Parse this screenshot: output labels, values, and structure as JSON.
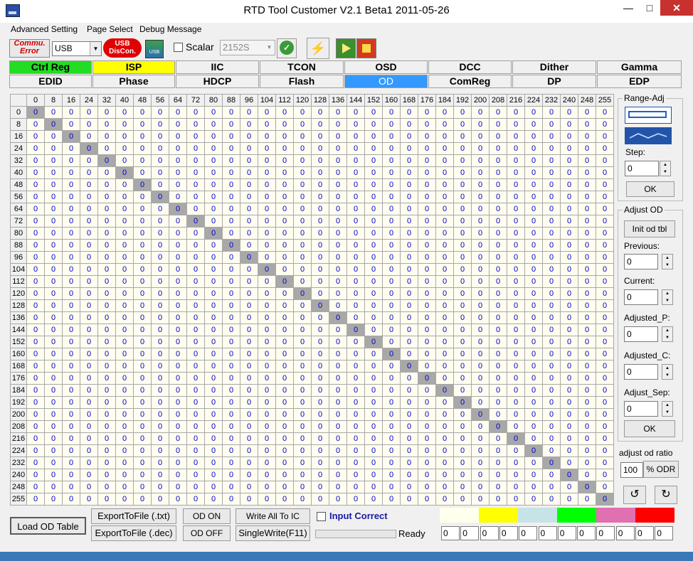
{
  "window": {
    "title": "RTD Tool Customer V2.1 Beta1   2011-05-26"
  },
  "menu": [
    "Advanced Setting",
    "Page Select",
    "Debug Message"
  ],
  "toolbar": {
    "status_line1": "Commu.",
    "status_line2": "Error",
    "port": "USB",
    "disconnect_line1": "USB",
    "disconnect_line2": "DisCon.",
    "usb_icon_label": "USB",
    "scalar_label": "Scalar",
    "scalar_value": "2152S"
  },
  "tabs_row1": [
    "Ctrl Reg",
    "ISP",
    "IIC",
    "TCON",
    "OSD",
    "DCC",
    "Dither",
    "Gamma"
  ],
  "tabs_row2": [
    "EDID",
    "Phase",
    "HDCP",
    "Flash",
    "OD",
    "ComReg",
    "DP",
    "EDP"
  ],
  "tab_colors": {
    "Ctrl Reg": "#22dd22",
    "ISP": "#ffff00",
    "OD": "#3399ff"
  },
  "od_table": {
    "columns": [
      0,
      8,
      16,
      24,
      32,
      40,
      48,
      56,
      64,
      72,
      80,
      88,
      96,
      104,
      112,
      120,
      128,
      136,
      144,
      152,
      160,
      168,
      176,
      184,
      192,
      200,
      208,
      216,
      224,
      232,
      240,
      248,
      255
    ],
    "rows": [
      0,
      8,
      16,
      24,
      32,
      40,
      48,
      56,
      64,
      72,
      80,
      88,
      96,
      104,
      112,
      120,
      128,
      136,
      144,
      152,
      160,
      168,
      176,
      184,
      192,
      200,
      208,
      216,
      224,
      232,
      240,
      248,
      255
    ],
    "cell_value": "0"
  },
  "range_adj": {
    "title": "Range-Adj",
    "step_label": "Step:",
    "step_value": "0",
    "ok_label": "OK"
  },
  "adjust_od": {
    "title": "Adjust OD",
    "init_label": "Init od tbl",
    "previous_label": "Previous:",
    "previous_value": "0",
    "current_label": "Current:",
    "current_value": "0",
    "adjusted_p_label": "Adjusted_P:",
    "adjusted_p_value": "0",
    "adjusted_c_label": "Adjusted_C:",
    "adjusted_c_value": "0",
    "adjust_sep_label": "Adjust_Sep:",
    "adjust_sep_value": "0",
    "ok_label": "OK"
  },
  "odr": {
    "label": "adjust od ratio",
    "value": "100",
    "unit": "% ODR"
  },
  "bottom": {
    "load_od_table": "Load OD Table",
    "export_txt": "ExportToFile (.txt)",
    "export_dec": "ExportToFile (.dec)",
    "od_on": "OD  ON",
    "od_off": "OD OFF",
    "write_all": "Write All To IC",
    "single_write": "SingleWrite(F11)",
    "input_correct": "Input Correct",
    "status": "Ready",
    "swatches": [
      "#ffffee",
      "#ffff00",
      "#c6e4e8",
      "#00ff00",
      "#e070b0",
      "#ff0000"
    ],
    "fields": [
      "0",
      "0",
      "0",
      "0",
      "0",
      "0",
      "0",
      "0",
      "0",
      "0",
      "0",
      "0"
    ]
  }
}
